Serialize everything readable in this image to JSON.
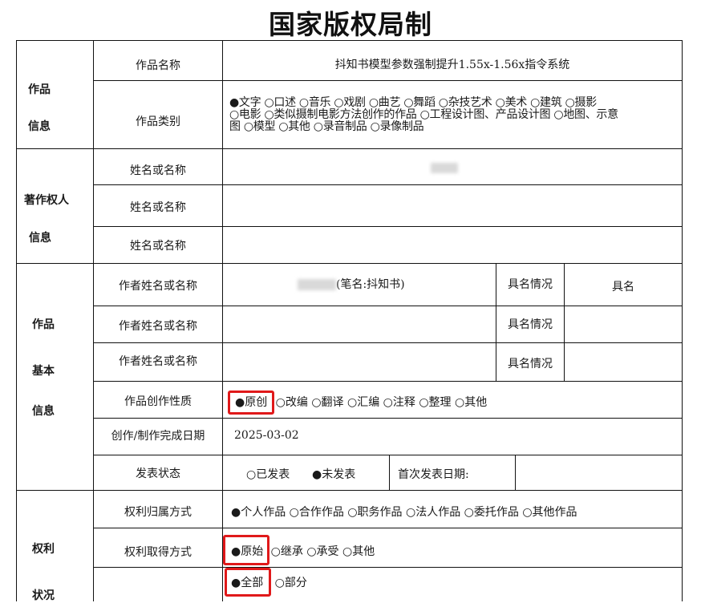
{
  "title": "国家版权局制",
  "sections": {
    "work_info": [
      "作品",
      "信息"
    ],
    "owner_info": [
      "著作权人",
      "信息"
    ],
    "basic_info": [
      "作品",
      "基本",
      "信息"
    ],
    "rights_info": [
      "权利",
      "状况"
    ]
  },
  "labels": {
    "work_name": "作品名称",
    "work_type": "作品类别",
    "owner_name_1": "姓名或名称",
    "owner_name_2": "姓名或名称",
    "owner_name_3": "姓名或名称",
    "author_1": "作者姓名或名称",
    "author_2": "作者姓名或名称",
    "author_3": "作者姓名或名称",
    "signature_1": "具名情况",
    "signature_2": "具名情况",
    "signature_3": "具名情况",
    "nature": "作品创作性质",
    "complete_date": "创作/制作完成日期",
    "publish_status": "发表状态",
    "first_publish_date": "首次发表日期:",
    "rights_ownership": "权利归属方式",
    "rights_acquisition": "权利取得方式"
  },
  "values": {
    "work_name": "抖知书模型参数强制提升1.55x-1.56x指令系统",
    "owner_name_1_suffix": "",
    "author_1_suffix": "(笔名:抖知书)",
    "signature_1_value": "具名",
    "complete_date": "2025-03-02"
  },
  "work_type_options": {
    "line1": "●文字 ○口述 ○音乐 ○戏剧 ○曲艺 ○舞蹈 ○杂技艺术 ○美术 ○建筑 ○摄影",
    "line2": "○电影 ○类似摄制电影方法创作的作品 ○工程设计图、产品设计图 ○地图、示意",
    "line3": "图 ○模型 ○其他 ○录音制品 ○录像制品"
  },
  "nature_options": {
    "selected": "●原创",
    "rest": "○改编 ○翻译 ○汇编 ○注释 ○整理 ○其他"
  },
  "publish_options": {
    "published": "○已发表",
    "unpublished": "●未发表"
  },
  "ownership_options": "●个人作品 ○合作作品 ○职务作品 ○法人作品 ○委托作品 ○其他作品",
  "acquisition_options": {
    "selected": "●原始",
    "rest": "○继承 ○承受 ○其他"
  },
  "scope_options": {
    "selected": "●全部",
    "rest": "○部分"
  },
  "colors": {
    "highlight": "#e0191a",
    "lines": "#111111"
  }
}
